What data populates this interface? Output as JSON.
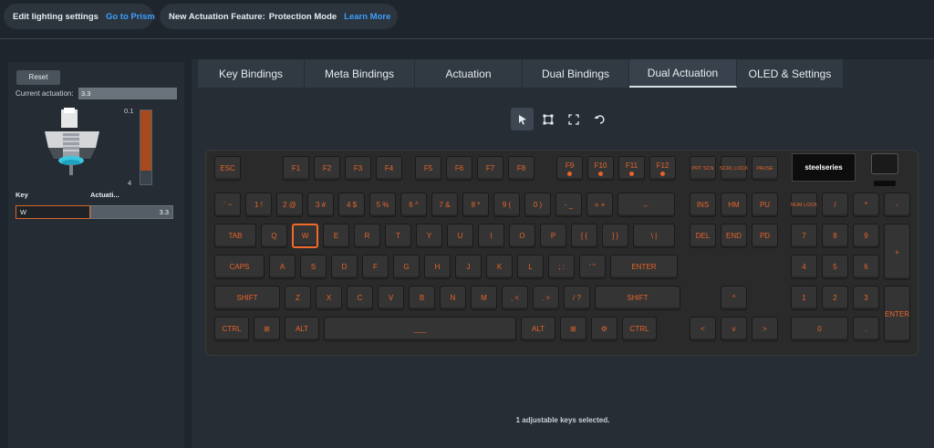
{
  "topbar": {
    "lighting_label": "Edit lighting settings",
    "lighting_link": "Go to Prism",
    "feature_label": "New Actuation Feature:",
    "feature_name": "Protection Mode",
    "feature_link": "Learn More"
  },
  "left": {
    "reset_label": "Reset",
    "current_label": "Current actuation:",
    "current_value": "3.3",
    "scale_top": "0.1",
    "scale_bottom": "4",
    "actuation_level": 3.3,
    "col_key": "Key",
    "col_actuation": "Actuati...",
    "rows": [
      {
        "key": "W",
        "actuation": "3.3"
      }
    ]
  },
  "tabs": [
    {
      "label": "Key Bindings",
      "active": false
    },
    {
      "label": "Meta Bindings",
      "active": false
    },
    {
      "label": "Actuation",
      "active": false
    },
    {
      "label": "Dual Bindings",
      "active": false
    },
    {
      "label": "Dual Actuation",
      "active": true
    },
    {
      "label": "OLED & Settings",
      "active": false
    }
  ],
  "tools": [
    {
      "icon": "pointer-icon",
      "active": true
    },
    {
      "icon": "select-area-icon",
      "active": false
    },
    {
      "icon": "expand-icon",
      "active": false
    },
    {
      "icon": "undo-icon",
      "active": false
    }
  ],
  "keyboard": {
    "brand": "steelseries",
    "accent_color": "#e8642a",
    "selected_key": "W",
    "keys": [
      {
        "l": "ESC"
      },
      {
        "l": "F1"
      },
      {
        "l": "F2"
      },
      {
        "l": "F3"
      },
      {
        "l": "F4"
      },
      {
        "l": "F5"
      },
      {
        "l": "F6"
      },
      {
        "l": "F7"
      },
      {
        "l": "F8"
      },
      {
        "l": "F9"
      },
      {
        "l": "F10"
      },
      {
        "l": "F11"
      },
      {
        "l": "F12"
      },
      {
        "l": "PRT SCN"
      },
      {
        "l": "SCRL LOCK"
      },
      {
        "l": "PAUSE"
      },
      {
        "l": "` ~"
      },
      {
        "l": "1 !"
      },
      {
        "l": "2 @"
      },
      {
        "l": "3 #"
      },
      {
        "l": "4 $"
      },
      {
        "l": "5 %"
      },
      {
        "l": "6 ^"
      },
      {
        "l": "7 &"
      },
      {
        "l": "8 *"
      },
      {
        "l": "9 ("
      },
      {
        "l": "0 )"
      },
      {
        "l": "- _"
      },
      {
        "l": "= +"
      },
      {
        "l": "←"
      },
      {
        "l": "INS"
      },
      {
        "l": "HM"
      },
      {
        "l": "PU"
      },
      {
        "l": "NUM LOCK"
      },
      {
        "l": "/"
      },
      {
        "l": "*"
      },
      {
        "l": "-"
      },
      {
        "l": "TAB"
      },
      {
        "l": "Q"
      },
      {
        "l": "W"
      },
      {
        "l": "E"
      },
      {
        "l": "R"
      },
      {
        "l": "T"
      },
      {
        "l": "Y"
      },
      {
        "l": "U"
      },
      {
        "l": "I"
      },
      {
        "l": "O"
      },
      {
        "l": "P"
      },
      {
        "l": "[ {"
      },
      {
        "l": "] }"
      },
      {
        "l": "\\ |"
      },
      {
        "l": "DEL"
      },
      {
        "l": "END"
      },
      {
        "l": "PD"
      },
      {
        "l": "7"
      },
      {
        "l": "8"
      },
      {
        "l": "9"
      },
      {
        "l": "+"
      },
      {
        "l": "CAPS"
      },
      {
        "l": "A"
      },
      {
        "l": "S"
      },
      {
        "l": "D"
      },
      {
        "l": "F"
      },
      {
        "l": "G"
      },
      {
        "l": "H"
      },
      {
        "l": "J"
      },
      {
        "l": "K"
      },
      {
        "l": "L"
      },
      {
        "l": "; :"
      },
      {
        "l": "' \""
      },
      {
        "l": "ENTER"
      },
      {
        "l": "4"
      },
      {
        "l": "5"
      },
      {
        "l": "6"
      },
      {
        "l": "SHIFT"
      },
      {
        "l": "Z"
      },
      {
        "l": "X"
      },
      {
        "l": "C"
      },
      {
        "l": "V"
      },
      {
        "l": "B"
      },
      {
        "l": "N"
      },
      {
        "l": "M"
      },
      {
        "l": ", <"
      },
      {
        "l": ". >"
      },
      {
        "l": "/ ?"
      },
      {
        "l": "SHIFT"
      },
      {
        "l": "^"
      },
      {
        "l": "1"
      },
      {
        "l": "2"
      },
      {
        "l": "3"
      },
      {
        "l": "ENTER"
      },
      {
        "l": "CTRL"
      },
      {
        "l": "⊞"
      },
      {
        "l": "ALT"
      },
      {
        "l": "___"
      },
      {
        "l": "ALT"
      },
      {
        "l": "⊞"
      },
      {
        "l": "⚙"
      },
      {
        "l": "CTRL"
      },
      {
        "l": "<"
      },
      {
        "l": "v"
      },
      {
        "l": ">"
      },
      {
        "l": "0"
      },
      {
        "l": "."
      }
    ]
  },
  "status": "1 adjustable keys selected."
}
